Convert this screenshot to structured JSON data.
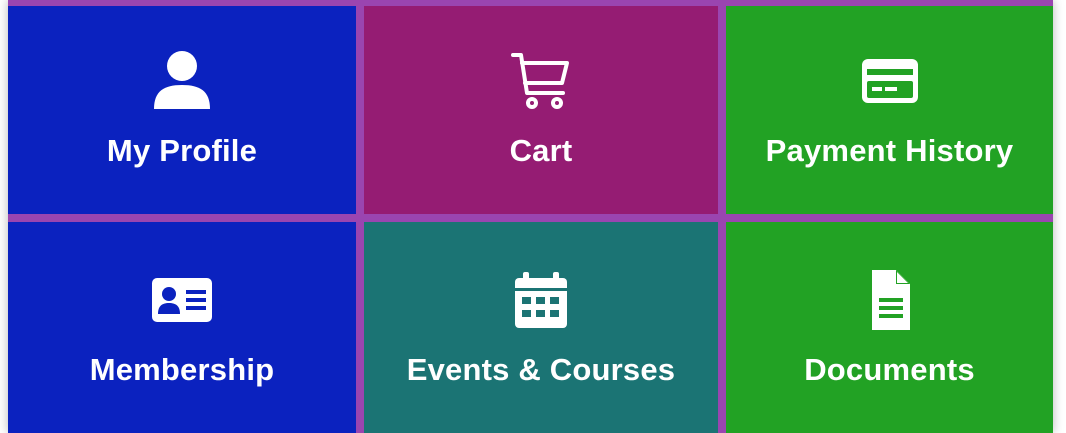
{
  "tiles": [
    {
      "label": "My Profile",
      "icon": "user-icon",
      "color": "#0b22bf"
    },
    {
      "label": "Cart",
      "icon": "cart-icon",
      "color": "#951c73"
    },
    {
      "label": "Payment History",
      "icon": "credit-card-icon",
      "color": "#22a224"
    },
    {
      "label": "Membership",
      "icon": "id-card-icon",
      "color": "#0b22bf"
    },
    {
      "label": "Events & Courses",
      "icon": "calendar-icon",
      "color": "#1b7474"
    },
    {
      "label": "Documents",
      "icon": "document-icon",
      "color": "#22a224"
    }
  ],
  "grid_border_color": "#9a45b0"
}
